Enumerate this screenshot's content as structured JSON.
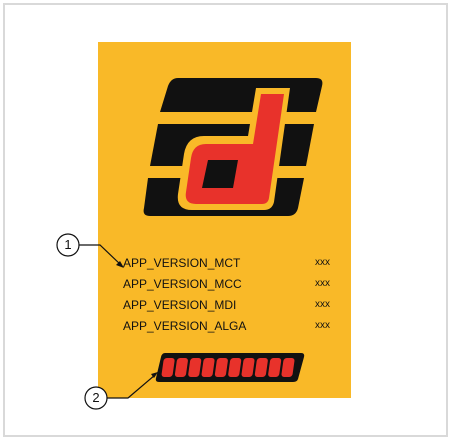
{
  "callouts": [
    {
      "number": "1",
      "target": "version list"
    },
    {
      "number": "2",
      "target": "progress bar"
    }
  ],
  "versions": [
    {
      "label": "APP_VERSION_MCT",
      "value": "xxx"
    },
    {
      "label": "APP_VERSION_MCC",
      "value": "xxx"
    },
    {
      "label": "APP_VERSION_MDI",
      "value": "xxx"
    },
    {
      "label": "APP_VERSION_ALGA",
      "value": "xxx"
    }
  ],
  "progress": {
    "segments_total": 10,
    "segments_filled": 10
  },
  "colors": {
    "screen_background": "#f9b928",
    "logo_black": "#111111",
    "logo_red": "#e8322b",
    "segment_red": "#e8322b"
  }
}
